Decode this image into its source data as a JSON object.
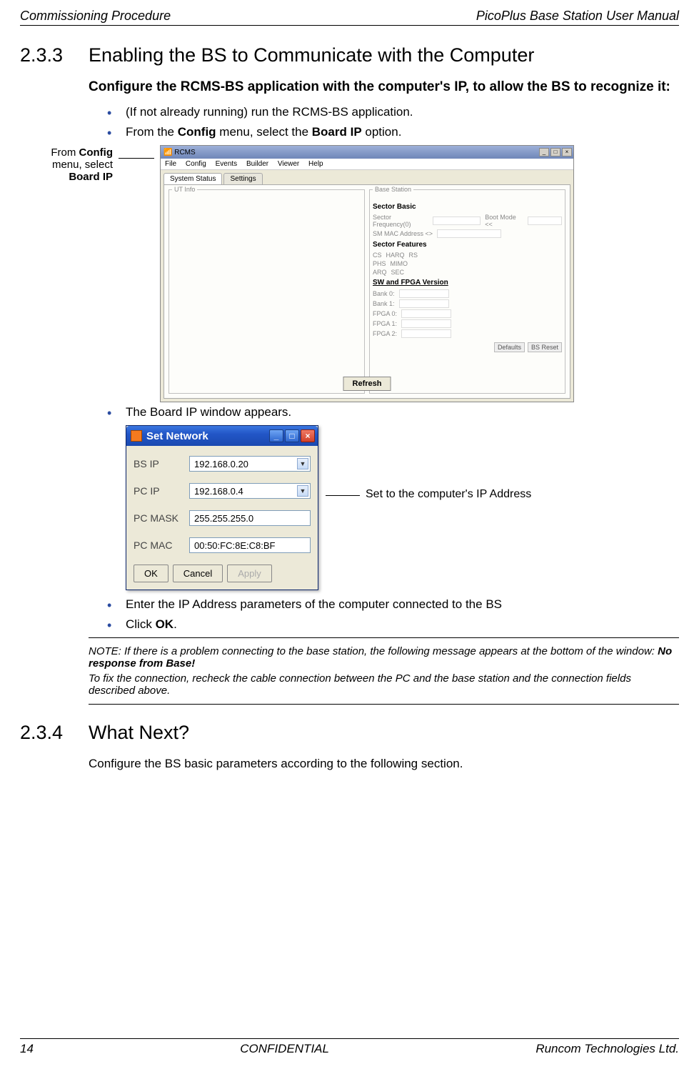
{
  "header": {
    "left": "Commissioning Procedure",
    "right": "PicoPlus Base Station User Manual"
  },
  "section233": {
    "num": "2.3.3",
    "title": "Enabling the BS to Communicate with the Computer",
    "sub": "Configure the RCMS-BS application with the computer's IP, to allow the BS to recognize it:",
    "b1": "(If not already running) run the RCMS-BS application.",
    "b2a": "From the ",
    "b2b": "Config",
    "b2c": " menu, select the ",
    "b2d": "Board IP",
    "b2e": " option.",
    "callout1": "From ",
    "callout1b": "Config",
    "callout2": "menu, select",
    "callout3": "Board IP",
    "b3": "The Board IP window appears.",
    "b4": "Enter the IP Address parameters of the computer connected to the BS",
    "b5a": "Click ",
    "b5b": "OK",
    "b5c": "."
  },
  "rcms": {
    "title": "RCMS",
    "menu": {
      "file": "File",
      "config": "Config",
      "events": "Events",
      "builder": "Builder",
      "viewer": "Viewer",
      "help": "Help"
    },
    "tab1": "System Status",
    "tab2": "Settings",
    "left_panel": "UT Info",
    "right_panel": "Base Station",
    "sector_basic": "Sector Basic",
    "freq_label": "Sector Frequency(0)",
    "boot_label": "Boot Mode <<",
    "mac_label": "SM MAC Address <>",
    "sector_features": "Sector Features",
    "feat1": "CS",
    "feat2": "HARQ",
    "feat3": "RS",
    "feat4": "PHS",
    "feat5": "MIMO",
    "feat6": "ARQ",
    "feat7": "SEC",
    "sw_ver": "SW and FPGA Version",
    "bank0": "Bank 0:",
    "bank1": "Bank 1:",
    "fpga0": "FPGA 0:",
    "fpga1": "FPGA 1:",
    "fpga2": "FPGA 2:",
    "defaults": "Defaults",
    "bsreset": "BS Reset",
    "refresh": "Refresh"
  },
  "setnet": {
    "title": "Set Network",
    "bs_ip_label": "BS IP",
    "bs_ip": "192.168.0.20",
    "pc_ip_label": "PC IP",
    "pc_ip": "192.168.0.4",
    "pc_mask_label": "PC MASK",
    "pc_mask": "255.255.255.0",
    "pc_mac_label": "PC MAC",
    "pc_mac": "00:50:FC:8E:C8:BF",
    "ok": "OK",
    "cancel": "Cancel",
    "apply": "Apply",
    "annot": "Set to the computer's IP Address"
  },
  "note": {
    "p1a": "NOTE: If there is a problem connecting to the base station, the following message appears at the bottom of the window: ",
    "p1b": "No response from Base!",
    "p2": "To fix the connection, recheck the cable connection between the PC and the base station and the connection fields described above."
  },
  "section234": {
    "num": "2.3.4",
    "title": "What Next?",
    "body": "Configure the BS basic parameters according to the following section."
  },
  "footer": {
    "left": "14",
    "center": "CONFIDENTIAL",
    "right": "Runcom Technologies Ltd."
  }
}
